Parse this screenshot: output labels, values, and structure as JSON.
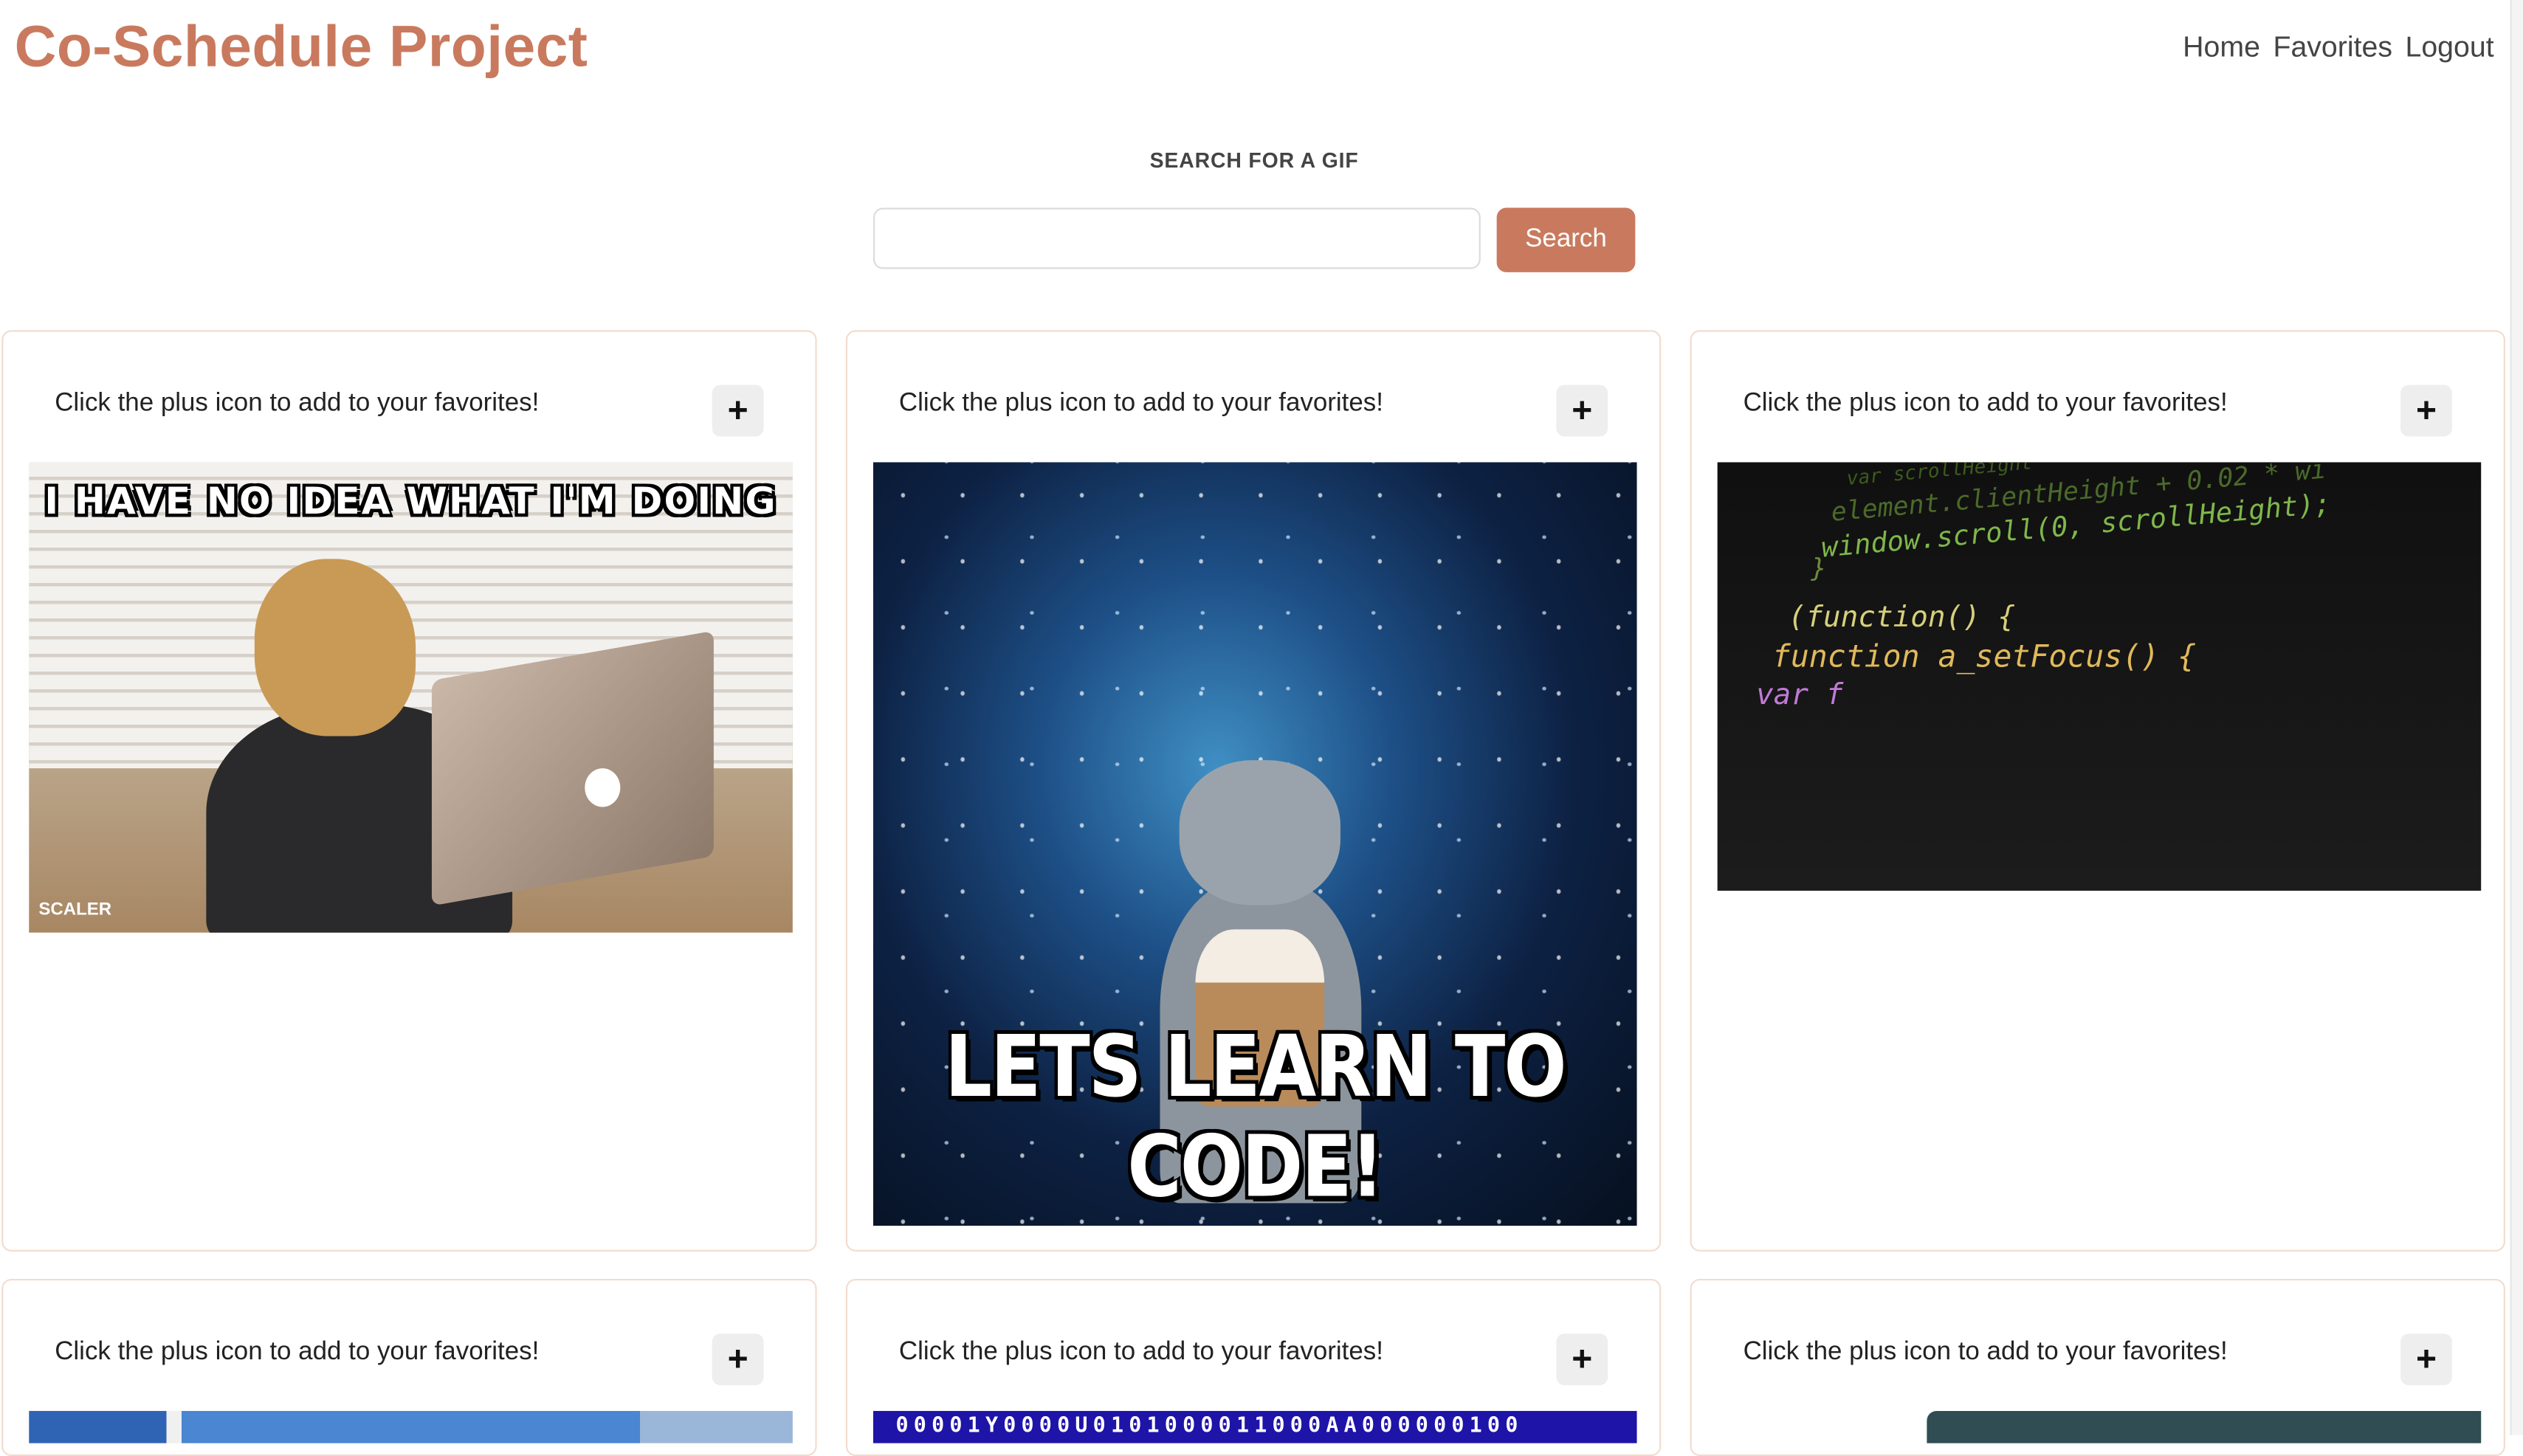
{
  "header": {
    "brand": "Co-Schedule Project",
    "nav": [
      "Home",
      "Favorites",
      "Logout"
    ]
  },
  "search": {
    "label": "SEARCH FOR A GIF",
    "value": "",
    "placeholder": "",
    "button_label": "Search"
  },
  "cards": [
    {
      "text": "Click the plus icon to add to your favorites!",
      "plus": "+",
      "gif_caption": "I HAVE NO IDEA WHAT I'M DOING",
      "gif_watermark": "SCALER"
    },
    {
      "text": "Click the plus icon to add to your favorites!",
      "plus": "+",
      "gif_caption": "LETS LEARN TO CODE!"
    },
    {
      "text": "Click the plus icon to add to your favorites!",
      "plus": "+",
      "code_lines": [
        "var scrollHeight",
        "element.clientHeight + 0.02 * wi",
        "window.scroll(0, scrollHeight);",
        "}",
        "(function() {",
        "function a_setFocus() {",
        "var f"
      ]
    },
    {
      "text": "Click the plus icon to add to your favorites!",
      "plus": "+"
    },
    {
      "text": "Click the plus icon to add to your favorites!",
      "plus": "+",
      "binary_strip": "00001Y0000U0101000011000AA000000100"
    },
    {
      "text": "Click the plus icon to add to your favorites!",
      "plus": "+"
    }
  ],
  "colors": {
    "accent": "#c97a5e",
    "card_border": "#f2dccf",
    "plus_bg": "#eeeeee"
  }
}
